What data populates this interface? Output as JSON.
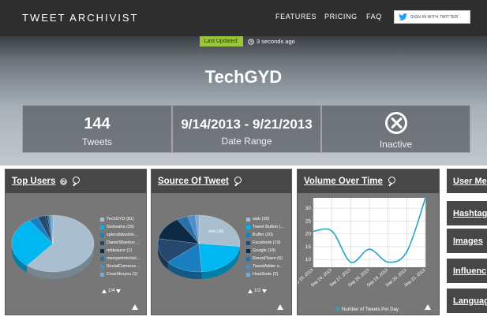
{
  "nav": {
    "logo": "TWEET ARCHIVIST",
    "links": [
      "FEATURES",
      "PRICING",
      "FAQ"
    ],
    "signin": "SIGN IN WITH TWITTER"
  },
  "hero": {
    "badge": "Last Updated:",
    "updated": "3 seconds ago",
    "title": "TechGYD",
    "stats": [
      {
        "value": "144",
        "label": "Tweets"
      },
      {
        "value": "9/14/2013 - 9/21/2013",
        "label": "Date Range"
      },
      {
        "label": "Inactive"
      }
    ]
  },
  "panels": {
    "top_users": {
      "title": "Top Users",
      "help": "?",
      "legend": [
        "TechGYD (81)",
        "Sorbsaha (39)",
        "splendidwoble...",
        "DanielSharkov ...",
        "oddsauce (1)",
        "marcpetrmichel...",
        "SocialComerce...",
        "Coachforyou (1)"
      ],
      "pager": "1/4",
      "slice_label": ""
    },
    "source": {
      "title": "Source Of Tweet",
      "legend": [
        "web (36)",
        "Tweet Button (...",
        "Buffer (20)",
        "Facebook (19)",
        "Google (18)",
        "RoundTeam (6)",
        "TweetAdder v...",
        "HootSuite (2)"
      ],
      "pager": "1/2",
      "slice_label": "web (36)"
    },
    "volume": {
      "title": "Volume Over Time",
      "legend": "Number of Tweets Per Day"
    }
  },
  "side_menu": [
    "User Me",
    "Hashtag",
    "Images",
    "Influenc",
    "Language"
  ],
  "colors": {
    "nav_bg": "#2e2e2e",
    "badge": "#9ac43c",
    "panel_bg": "#777777",
    "panel_head": "#474747",
    "line": "#22a3c8"
  },
  "pie_colors": [
    "#a9bfcf",
    "#00b7f1",
    "#1a7fc1",
    "#25496e",
    "#0d2a44",
    "#2a6fa8",
    "#4d8ec6",
    "#7aa8d4"
  ],
  "chart_data": [
    {
      "type": "pie",
      "title": "Top Users",
      "categories": [
        "TechGYD",
        "Sorbsaha",
        "splendidwoble...",
        "DanielSharkov ...",
        "oddsauce",
        "marcpetrmichel...",
        "SocialComerce...",
        "Coachforyou"
      ],
      "values": [
        81,
        39,
        5,
        4,
        1,
        1,
        1,
        1
      ]
    },
    {
      "type": "pie",
      "title": "Source Of Tweet",
      "categories": [
        "web",
        "Tweet Button",
        "Buffer",
        "Facebook",
        "Google",
        "RoundTeam",
        "TweetAdder v...",
        "HootSuite"
      ],
      "values": [
        36,
        30,
        20,
        19,
        18,
        6,
        4,
        2
      ]
    },
    {
      "type": "line",
      "title": "Volume Over Time",
      "x": [
        "Sep 15, 2013",
        "Sep 16, 2013",
        "Sep 17, 2013",
        "Sep 18, 2013",
        "Sep 19, 2013",
        "Sep 20, 2013",
        "Sep 21, 2013"
      ],
      "series": [
        {
          "name": "Number of Tweets Per Day",
          "values": [
            21,
            21,
            9,
            14,
            9,
            13,
            34
          ]
        }
      ],
      "ylim": [
        7,
        34
      ],
      "yticks": [
        10,
        15,
        20,
        25,
        30
      ],
      "grid": true,
      "legend": "bottom"
    }
  ]
}
